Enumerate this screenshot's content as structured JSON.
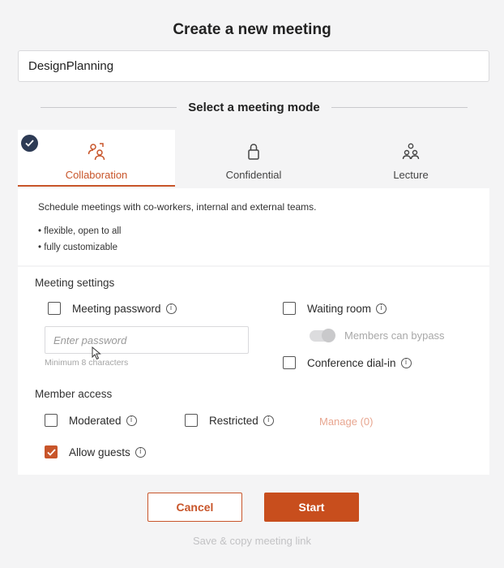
{
  "dialog": {
    "title": "Create a new meeting",
    "meeting_name": "DesignPlanning",
    "mode_heading": "Select a meeting mode"
  },
  "modes": [
    {
      "label": "Collaboration",
      "icon": "collaboration-icon",
      "selected": true
    },
    {
      "label": "Confidential",
      "icon": "lock-icon",
      "selected": false
    },
    {
      "label": "Lecture",
      "icon": "audience-icon",
      "selected": false
    }
  ],
  "mode_description": {
    "text": "Schedule meetings with co-workers, internal and external teams.",
    "bullets": [
      "• flexible, open to all",
      "• fully customizable"
    ]
  },
  "meeting_settings": {
    "title": "Meeting settings",
    "password_label": "Meeting password",
    "password_placeholder": "Enter password",
    "password_hint": "Minimum 8 characters",
    "waiting_room_label": "Waiting room",
    "bypass_label": "Members can bypass",
    "dial_in_label": "Conference dial-in"
  },
  "member_access": {
    "title": "Member access",
    "moderated_label": "Moderated",
    "restricted_label": "Restricted",
    "manage_label": "Manage (0)",
    "allow_guests_label": "Allow guests",
    "allow_guests_checked": true
  },
  "actions": {
    "cancel_label": "Cancel",
    "start_label": "Start",
    "copy_link_label": "Save & copy meeting link"
  },
  "colors": {
    "accent": "#c8552a",
    "badge": "#2d3b55"
  }
}
